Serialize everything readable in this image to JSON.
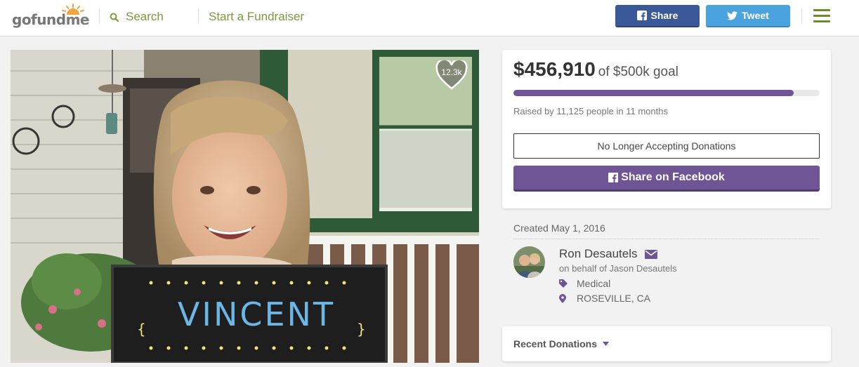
{
  "header": {
    "logo_text_1": "gofund",
    "logo_text_2": "me",
    "search_label": "Search",
    "start_label": "Start a Fundraiser",
    "share_label": "Share",
    "tweet_label": "Tweet"
  },
  "photo": {
    "likes": "12.3k",
    "sign_text": "VINCENT"
  },
  "donate": {
    "amount": "$456,910",
    "goal": "of $500k goal",
    "progress_fraction": 0.914,
    "raised_by": "Raised by 11,125 people in 11 months",
    "no_longer": "No Longer Accepting Donations",
    "fb_share": "Share on Facebook"
  },
  "info": {
    "created": "Created May 1, 2016",
    "organizer": "Ron Desautels",
    "behalf": "on behalf of Jason Desautels",
    "category": "Medical",
    "location": "ROSEVILLE, CA"
  },
  "recent": {
    "label": "Recent Donations"
  },
  "colors": {
    "purple": "#6f5496",
    "green_link": "#7a9a3c",
    "facebook": "#3b5998",
    "twitter": "#4aa3df"
  }
}
